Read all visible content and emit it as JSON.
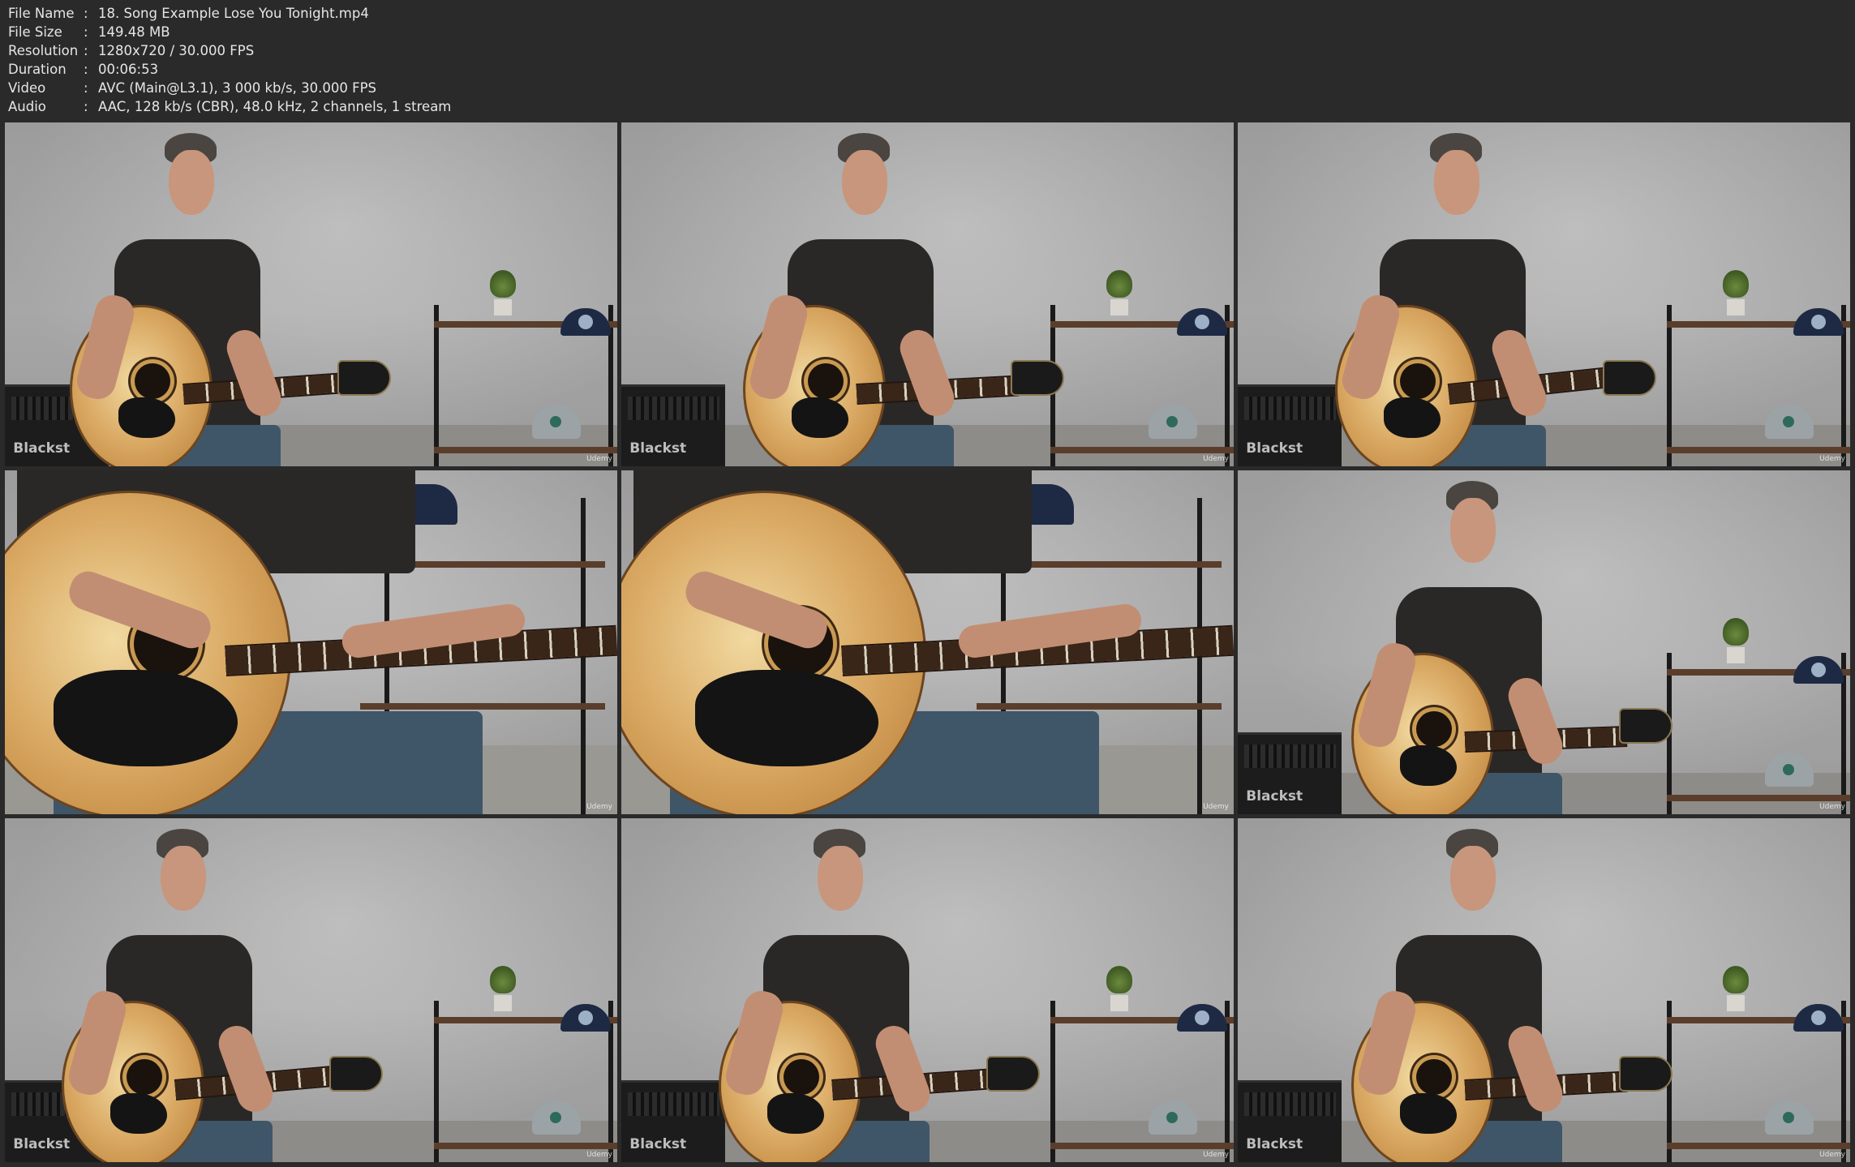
{
  "info": [
    {
      "key": "File Name",
      "value": "18. Song Example Lose You Tonight.mp4"
    },
    {
      "key": "File Size",
      "value": "149.48 MB"
    },
    {
      "key": "Resolution",
      "value": "1280x720 / 30.000 FPS"
    },
    {
      "key": "Duration",
      "value": "00:06:53"
    },
    {
      "key": "Video",
      "value": "AVC (Main@L3.1), 3 000 kb/s, 30.000 FPS"
    },
    {
      "key": "Audio",
      "value": "AAC, 128 kb/s (CBR), 48.0 kHz, 2 channels, 1 stream"
    }
  ],
  "separator": ":",
  "amp_label": "Blackst",
  "watermark": "Udemy",
  "thumbnails": [
    {
      "shot": "wide"
    },
    {
      "shot": "wide"
    },
    {
      "shot": "wide"
    },
    {
      "shot": "closeup"
    },
    {
      "shot": "closeup"
    },
    {
      "shot": "wide"
    },
    {
      "shot": "wide"
    },
    {
      "shot": "wide"
    },
    {
      "shot": "wide"
    }
  ]
}
